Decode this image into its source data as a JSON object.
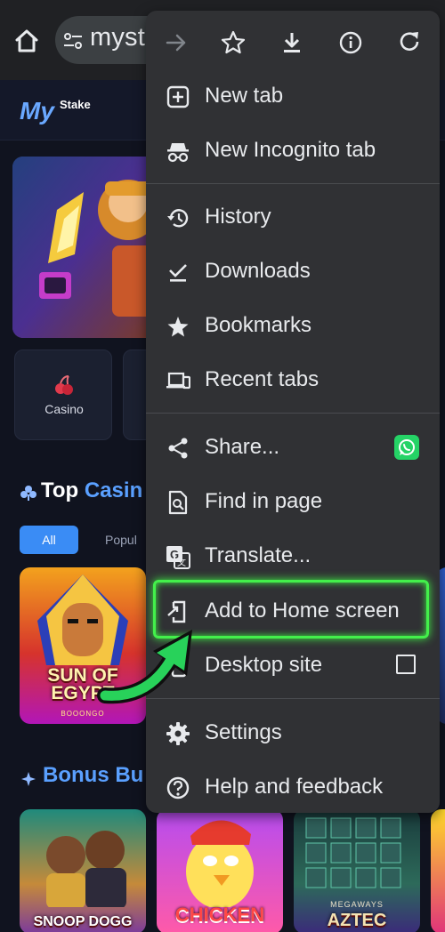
{
  "browser": {
    "url_text": "myst"
  },
  "site": {
    "logo_text": "My",
    "logo_sub": "Stake",
    "category_label": "Casino",
    "top_section": {
      "prefix": "Top ",
      "accent": "Casin"
    },
    "chips": [
      "All",
      "Popul"
    ],
    "bonus_section": {
      "prefix": "Bonus Bu"
    },
    "games": {
      "egypt_title": "SUN OF EGYPT",
      "egypt_brand": "BOOONGO",
      "snoop_title": "SNOOP DOGG",
      "chicken_title": "CHICKEN",
      "aztec_sub": "MEGAWAYS",
      "aztec_title": "AZTEC"
    }
  },
  "menu": {
    "toolbar": [
      "forward-icon",
      "star-icon",
      "download-icon",
      "info-icon",
      "refresh-icon"
    ],
    "items": [
      {
        "label": "New tab",
        "icon": "new-tab-icon"
      },
      {
        "label": "New Incognito tab",
        "icon": "incognito-icon"
      },
      {
        "label": "History",
        "icon": "history-icon"
      },
      {
        "label": "Downloads",
        "icon": "downloads-icon"
      },
      {
        "label": "Bookmarks",
        "icon": "bookmarks-star-icon"
      },
      {
        "label": "Recent tabs",
        "icon": "recent-tabs-icon"
      },
      {
        "label": "Share...",
        "icon": "share-icon"
      },
      {
        "label": "Find in page",
        "icon": "find-in-page-icon"
      },
      {
        "label": "Translate...",
        "icon": "translate-icon"
      },
      {
        "label": "Add to Home screen",
        "icon": "add-to-home-icon"
      },
      {
        "label": "Desktop site",
        "icon": "desktop-site-icon"
      },
      {
        "label": "Settings",
        "icon": "settings-gear-icon"
      },
      {
        "label": "Help and feedback",
        "icon": "help-icon"
      }
    ],
    "highlight_color": "#43f04b",
    "accent_whatsapp": "#25d366"
  }
}
